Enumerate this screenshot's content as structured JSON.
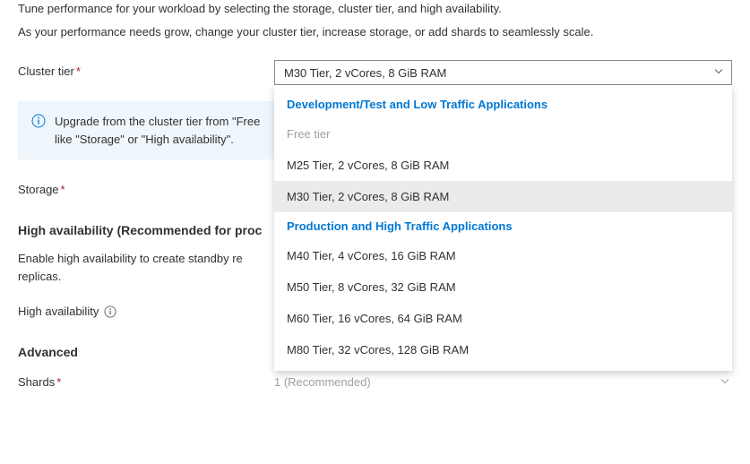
{
  "intro": {
    "line1": "Tune performance for your workload by selecting the storage, cluster tier, and high availability.",
    "line2": "As your performance needs grow, change your cluster tier, increase storage, or add shards to seamlessly scale."
  },
  "cluster_tier": {
    "label": "Cluster tier",
    "selected": "M30 Tier, 2 vCores, 8 GiB RAM",
    "groups": [
      {
        "header": "Development/Test and Low Traffic Applications",
        "options": [
          {
            "label": "Free tier",
            "disabled": true,
            "selected": false
          },
          {
            "label": "M25 Tier, 2 vCores, 8 GiB RAM",
            "disabled": false,
            "selected": false
          },
          {
            "label": "M30 Tier, 2 vCores, 8 GiB RAM",
            "disabled": false,
            "selected": true
          }
        ]
      },
      {
        "header": "Production and High Traffic Applications",
        "options": [
          {
            "label": "M40 Tier, 4 vCores, 16 GiB RAM",
            "disabled": false,
            "selected": false
          },
          {
            "label": "M50 Tier, 8 vCores, 32 GiB RAM",
            "disabled": false,
            "selected": false
          },
          {
            "label": "M60 Tier, 16 vCores, 64 GiB RAM",
            "disabled": false,
            "selected": false
          },
          {
            "label": "M80 Tier, 32 vCores, 128 GiB RAM",
            "disabled": false,
            "selected": false
          }
        ]
      }
    ]
  },
  "info_message": {
    "line1": "Upgrade from the cluster tier from \"Free",
    "line2": "like \"Storage\" or \"High availability\"."
  },
  "storage": {
    "label": "Storage"
  },
  "high_availability": {
    "heading": "High availability (Recommended for proc",
    "description": "Enable high availability to create standby re­plicas.",
    "desc_line1": "Enable high availability to create standby re",
    "desc_line2": "replicas.",
    "label": "High availability"
  },
  "advanced": {
    "heading": "Advanced"
  },
  "shards": {
    "label": "Shards",
    "value": "1 (Recommended)"
  },
  "required_mark": "*"
}
